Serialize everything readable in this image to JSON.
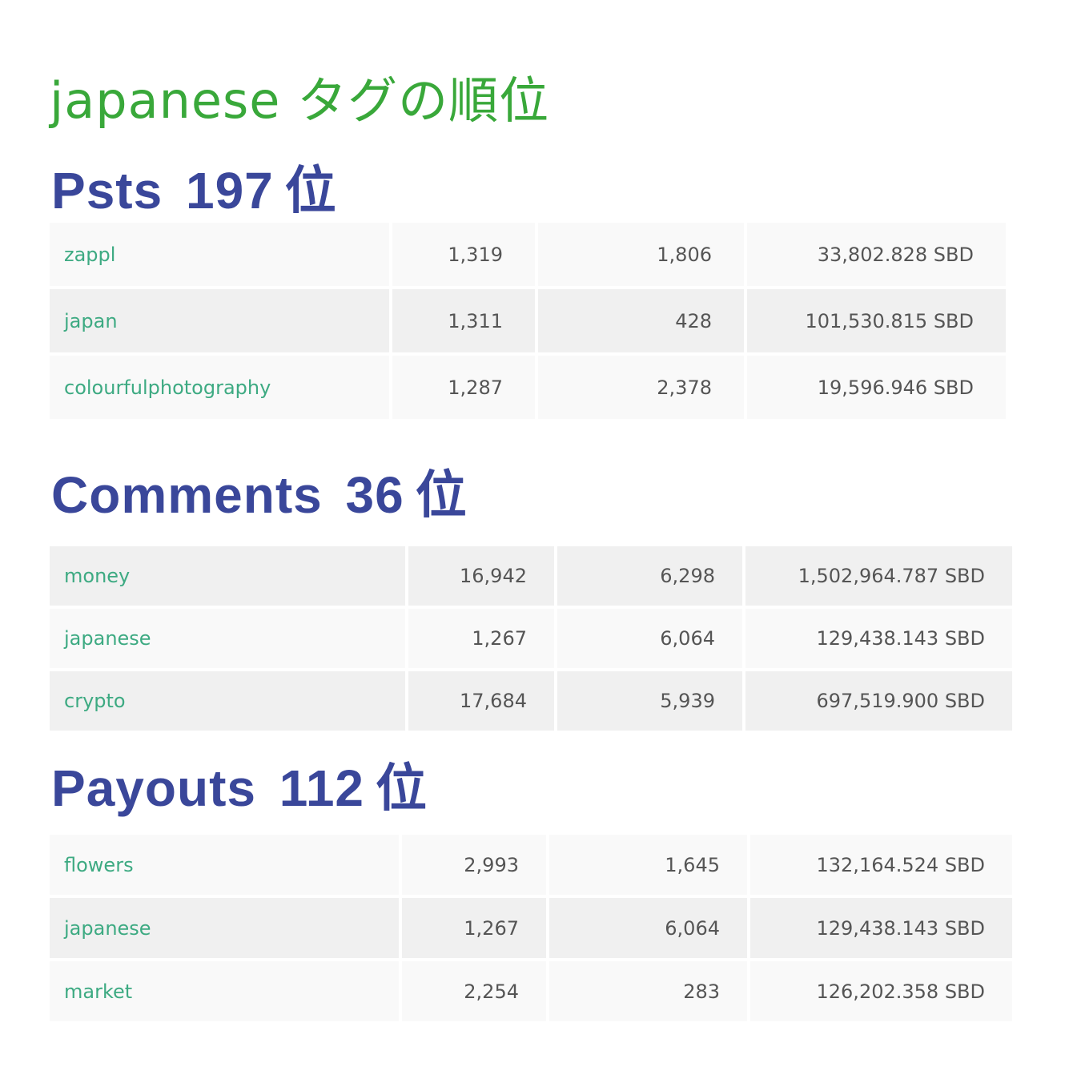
{
  "title": "japanese タグの順位",
  "sections": {
    "posts": {
      "label": "Psts",
      "rank": "197",
      "suffix": "位",
      "rows": [
        {
          "tag": "zappl",
          "posts": "1,319",
          "comments": "1,806",
          "payouts": "33,802.828 SBD"
        },
        {
          "tag": "japan",
          "posts": "1,311",
          "comments": "428",
          "payouts": "101,530.815 SBD"
        },
        {
          "tag": "colourfulphotography",
          "posts": "1,287",
          "comments": "2,378",
          "payouts": "19,596.946 SBD"
        }
      ]
    },
    "comments": {
      "label": "Comments",
      "rank": "36",
      "suffix": "位",
      "rows": [
        {
          "tag": "money",
          "posts": "16,942",
          "comments": "6,298",
          "payouts": "1,502,964.787 SBD"
        },
        {
          "tag": "japanese",
          "posts": "1,267",
          "comments": "6,064",
          "payouts": "129,438.143 SBD"
        },
        {
          "tag": "crypto",
          "posts": "17,684",
          "comments": "5,939",
          "payouts": "697,519.900 SBD"
        }
      ]
    },
    "payouts": {
      "label": "Payouts",
      "rank": "112",
      "suffix": "位",
      "rows": [
        {
          "tag": "flowers",
          "posts": "2,993",
          "comments": "1,645",
          "payouts": "132,164.524 SBD"
        },
        {
          "tag": "japanese",
          "posts": "1,267",
          "comments": "6,064",
          "payouts": "129,438.143 SBD"
        },
        {
          "tag": "market",
          "posts": "2,254",
          "comments": "283",
          "payouts": "126,202.358 SBD"
        }
      ]
    }
  },
  "colors": {
    "title": "#39a83a",
    "heading": "#3a479a",
    "tag_link": "#3daa82",
    "cell_text": "#555555",
    "row_light": "#f9f9f9",
    "row_dark": "#f0f0f0"
  }
}
